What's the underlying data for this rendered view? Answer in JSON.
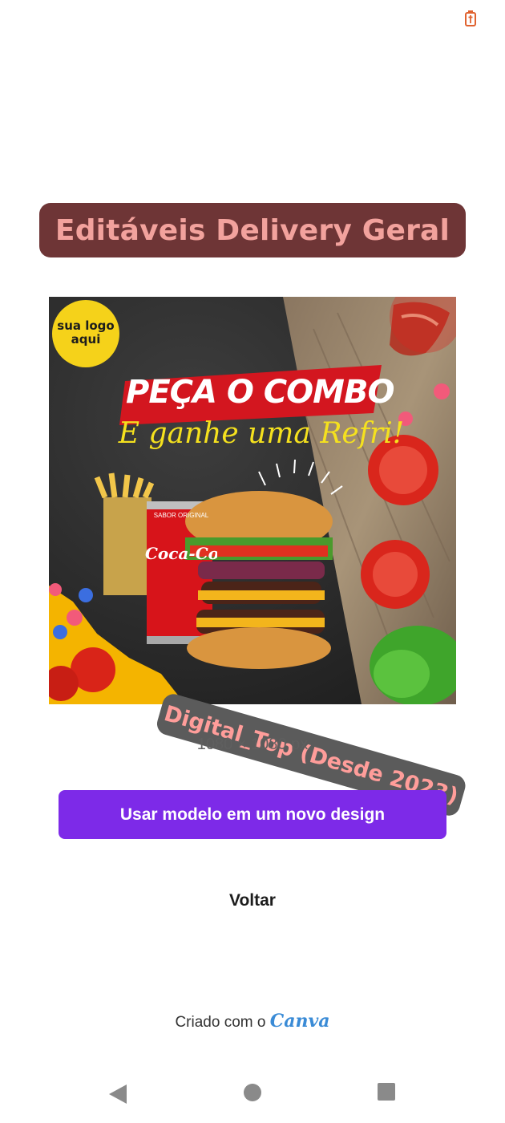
{
  "header": {
    "title": "Editáveis Delivery Geral"
  },
  "template": {
    "logo_placeholder_line1": "sua logo",
    "logo_placeholder_line2": "aqui",
    "headline": "PEÇA O COMBO",
    "subheadline": "E ganhe uma Refri!",
    "can_small_text": "SABOR ORIGINAL",
    "can_brand": "Coca-Cola"
  },
  "watermark": {
    "text": "Digital_Top (Desde 2023)"
  },
  "dimensions_label": "1080 × 1080 px",
  "actions": {
    "use_template_label": "Usar modelo em um novo design",
    "back_label": "Voltar"
  },
  "footer": {
    "created_with": "Criado com o",
    "brand": "Canva"
  },
  "icons": {
    "status": "battery-charging-icon",
    "nav": [
      "back-triangle-icon",
      "home-circle-icon",
      "recents-square-icon"
    ]
  },
  "colors": {
    "accent": "#7d2ae8",
    "title_banner_bg": "#6e3536",
    "title_text": "#f2a29d",
    "watermark_text": "#ff9d9a"
  }
}
